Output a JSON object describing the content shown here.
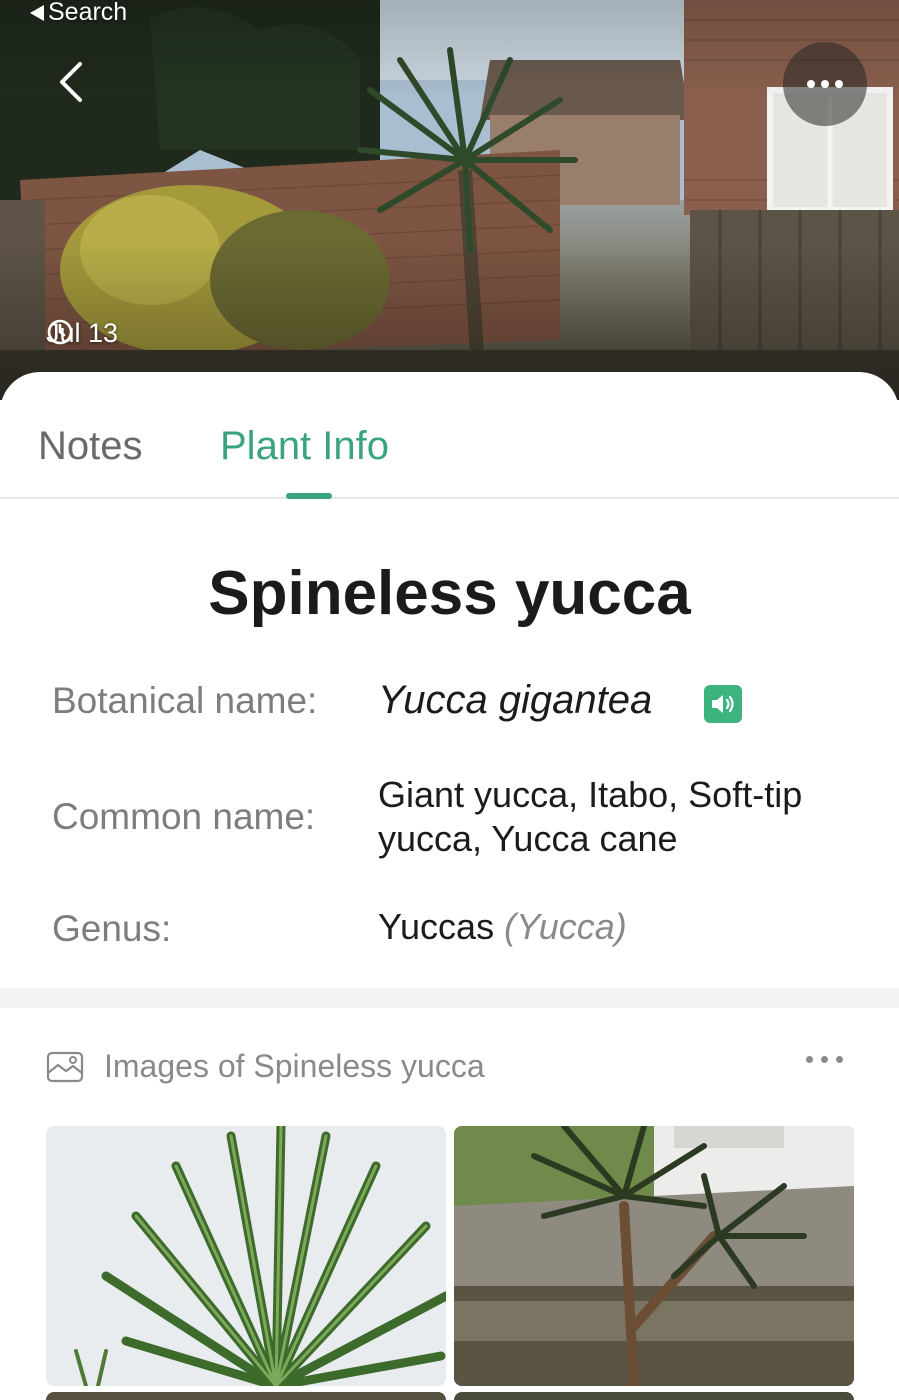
{
  "status_bar": {
    "back_label": "Search"
  },
  "hero": {
    "date": "Jul 13"
  },
  "tabs": [
    {
      "label": "Notes",
      "active": false
    },
    {
      "label": "Plant Info",
      "active": true
    }
  ],
  "plant": {
    "title": "Spineless yucca",
    "botanical_label": "Botanical name:",
    "botanical_value": "Yucca gigantea",
    "common_label": "Common name:",
    "common_value_line1": "Giant yucca, Itabo, Soft-tip",
    "common_value_line2": "yucca, Yucca cane",
    "genus_label": "Genus:",
    "genus_value": "Yuccas",
    "genus_latin": "(Yucca)"
  },
  "images": {
    "header": "Images of Spineless yucca"
  },
  "colors": {
    "accent": "#3aa57a",
    "speaker": "#3fb37f"
  },
  "icons": [
    "chevron-left-icon",
    "more-icon",
    "clock-icon",
    "speaker-icon",
    "image-gallery-icon"
  ]
}
